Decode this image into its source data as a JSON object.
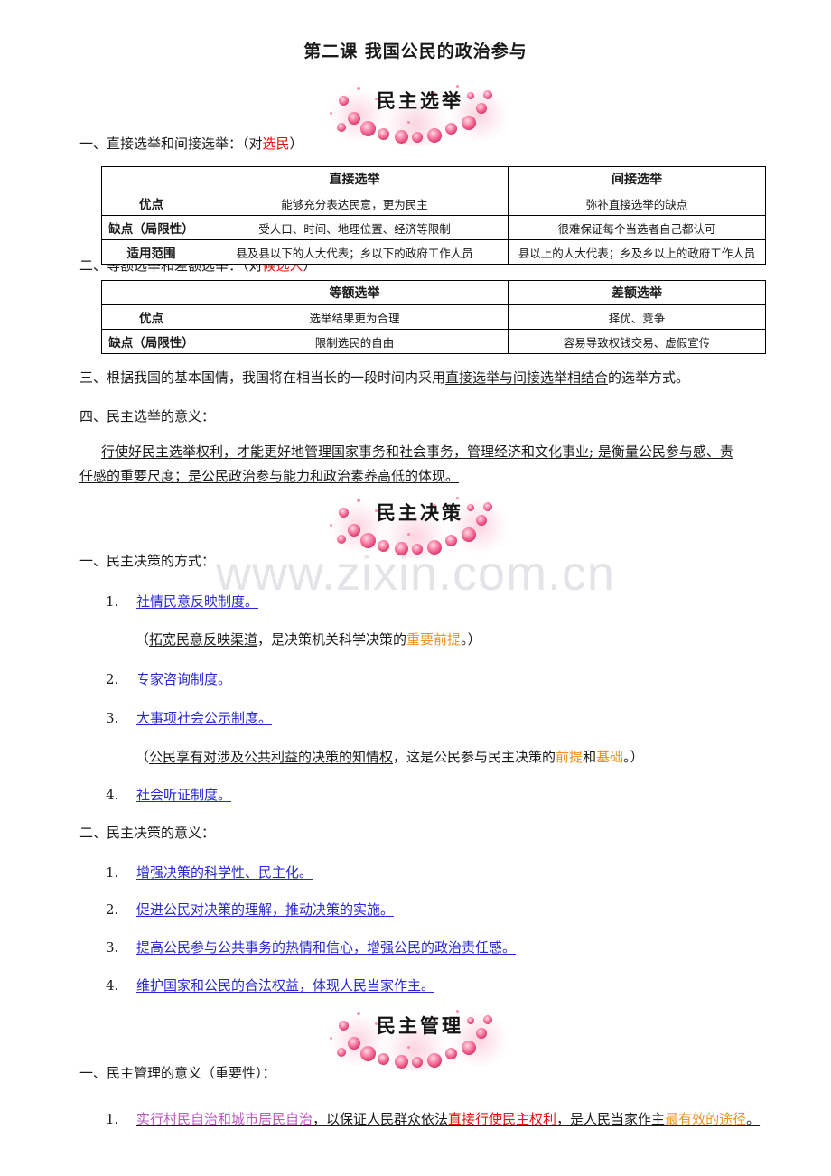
{
  "document": {
    "title": "第二课 我国公民的政治参与",
    "watermark": "www.zixin.com.cn"
  },
  "sections": [
    {
      "banner": "民主选举"
    },
    {
      "banner": "民主决策"
    },
    {
      "banner": "民主管理"
    }
  ],
  "election": {
    "heading_prefix": "一、直接选举和间接选举：（对",
    "heading_highlight": "选民",
    "heading_suffix": "）",
    "table1": {
      "columns": [
        "",
        "直接选举",
        "间接选举"
      ],
      "rows": [
        {
          "label": "优点",
          "direct": "能够充分表达民意，更为民主",
          "indirect": "弥补直接选举的缺点"
        },
        {
          "label": "缺点（局限性）",
          "direct": "受人口、时间、地理位置、经济等限制",
          "indirect": "很难保证每个当选者自己都认可"
        },
        {
          "label": "适用范围",
          "direct": "县及县以下的人大代表；乡以下的政府工作人员",
          "indirect": "县以上的人大代表；乡及乡以上的政府工作人员"
        }
      ]
    },
    "heading2_prefix": "二、等额选举和差额选举：（对",
    "heading2_highlight": "候选人",
    "heading2_suffix": "）",
    "table2": {
      "columns": [
        "",
        "等额选举",
        "差额选举"
      ],
      "rows": [
        {
          "label": "优点",
          "equal": "选举结果更为合理",
          "differential": "择优、竞争"
        },
        {
          "label": "缺点（局限性）",
          "equal": "限制选民的自由",
          "differential": "容易导致权钱交易、虚假宣传"
        }
      ]
    },
    "point3_prefix": "三、根据我国的基本国情，我国将在相当长的一段时间内采用",
    "point3_underline": "直接选举与间接选举相结合",
    "point3_suffix": "的选举方式。",
    "point4": "四、民主选举的意义：",
    "meaning_line1": "行使好民主选举权利，才能更好地管理国家事务和社会事务，管理经济和文化事业; 是衡量公民参与感、责",
    "meaning_line2": "任感的重要尺度；是公民政治参与能力和政治素养高低的体现。"
  },
  "decision": {
    "heading1": "一、民主决策的方式：",
    "methods": [
      {
        "num": "1.",
        "text": "社情民意反映制度。"
      },
      {
        "num": "2.",
        "text": "专家咨询制度。"
      },
      {
        "num": "3.",
        "text": "大事项社会公示制度。"
      },
      {
        "num": "4.",
        "text": "社会听证制度。"
      }
    ],
    "note1": {
      "open": "（",
      "underline": "拓宽民意反映渠道",
      "middle": "，是决策机关科学决策的",
      "highlight": "重要前提",
      "close": "。）"
    },
    "note2": {
      "open": "（",
      "underline": "公民享有对涉及公共利益的决策的知情权",
      "middle": "，这是公民参与民主决策的",
      "highlight1": "前提",
      "joiner": "和",
      "highlight2": "基础",
      "close": "。）"
    },
    "heading2": "二、民主决策的意义：",
    "meanings": [
      {
        "num": "1.",
        "text": "增强决策的科学性、民主化。"
      },
      {
        "num": "2.",
        "text": "促进公民对决策的理解，推动决策的实施。"
      },
      {
        "num": "3.",
        "text": "提高公民参与公共事务的热情和信心，增强公民的政治责任感。"
      },
      {
        "num": "4.",
        "text": "维护国家和公民的合法权益，体现人民当家作主。"
      }
    ]
  },
  "management": {
    "heading1": "一、民主管理的意义（重要性）：",
    "item1": {
      "num": "1.",
      "purple": "实行村民自治和城市居民自治",
      "black1": "，以保证人民群众依法",
      "red": "直接行使民主权利",
      "black2": "，是人民当家作主",
      "orange": "最有效的途径",
      "tail": "。"
    }
  },
  "colors": {
    "red": "#e8120c",
    "orange": "#f0921e",
    "blue": "#2828d8",
    "purple": "#c05ac0",
    "watermark": "#e4e4e8"
  }
}
